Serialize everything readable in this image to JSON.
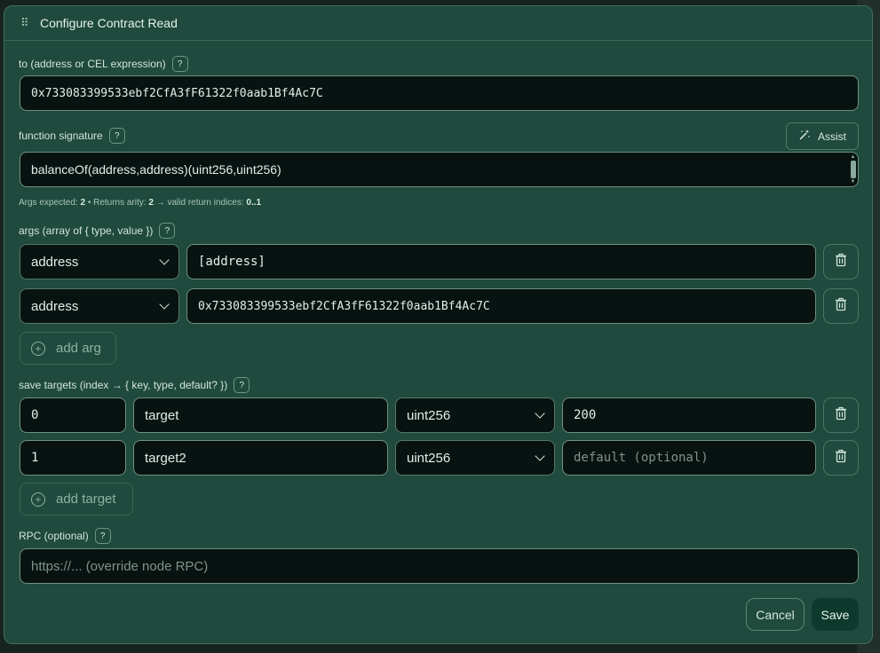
{
  "dialog": {
    "title": "Configure Contract Read"
  },
  "to": {
    "label": "to (address or CEL expression)",
    "help": "?",
    "value": "0x733083399533ebf2CfA3fF61322f0aab1Bf4Ac7C"
  },
  "function_signature": {
    "label": "function signature",
    "help": "?",
    "assist_label": "Assist",
    "value": "balanceOf(address,address)(uint256,uint256)",
    "hint_prefix": "Args expected: ",
    "args_expected": "2",
    "hint_mid": " • Returns arity: ",
    "returns_arity": "2",
    "hint_suffix": " → valid return indices: ",
    "valid_indices": "0..1"
  },
  "args": {
    "label": "args (array of { type, value })",
    "help": "?",
    "rows": [
      {
        "type": "address",
        "value": "[address]"
      },
      {
        "type": "address",
        "value": "0x733083399533ebf2CfA3fF61322f0aab1Bf4Ac7C"
      }
    ],
    "add_label": "add arg"
  },
  "save_targets": {
    "label": "save targets (index → { key, type, default? })",
    "help": "?",
    "rows": [
      {
        "index": "0",
        "key": "target",
        "type": "uint256",
        "default": "200",
        "default_placeholder": "default (optional)"
      },
      {
        "index": "1",
        "key": "target2",
        "type": "uint256",
        "default": "",
        "default_placeholder": "default (optional)"
      }
    ],
    "add_label": "add target"
  },
  "rpc": {
    "label": "RPC (optional)",
    "help": "?",
    "placeholder": "https://... (override node RPC)",
    "value": ""
  },
  "footer": {
    "cancel_label": "Cancel",
    "save_label": "Save"
  },
  "colors": {
    "modal_bg": "#1f4a3d",
    "input_bg": "#081311",
    "save_bg": "#0e3a2d"
  }
}
